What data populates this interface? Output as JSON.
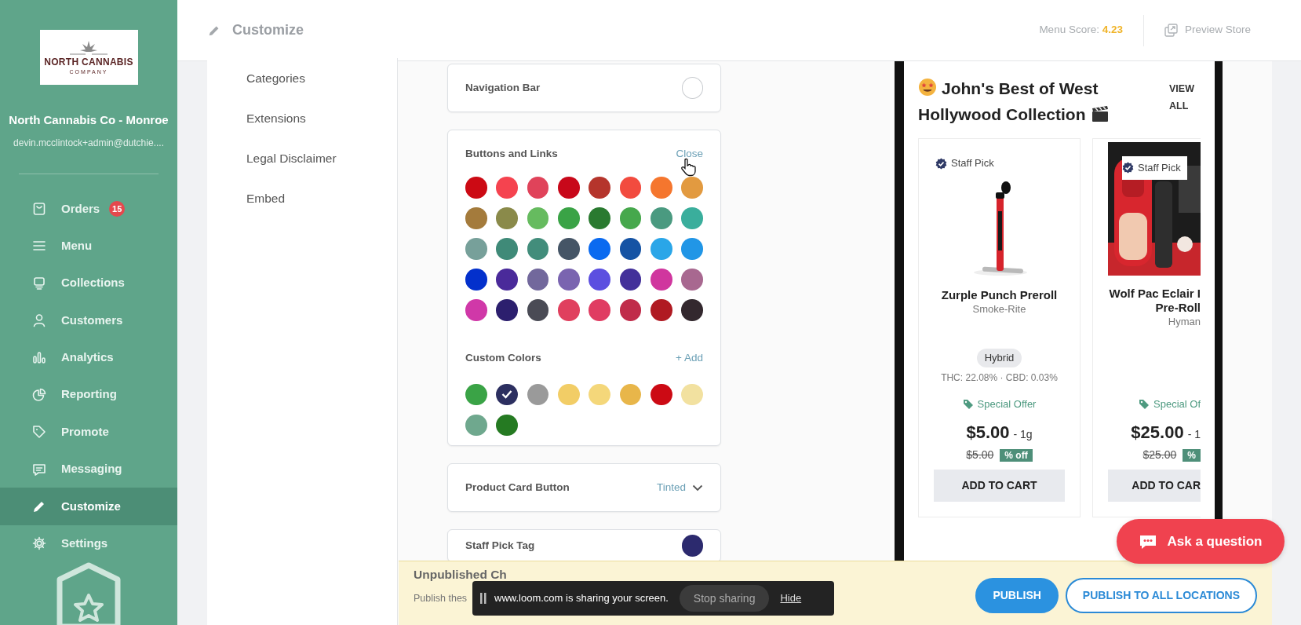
{
  "sidebar": {
    "logo": {
      "name": "NORTH CANNABIS",
      "tagline": "COMPANY"
    },
    "store_name": "North Cannabis Co - Monroe",
    "user_email": "devin.mcclintock+admin@dutchie....",
    "items": [
      {
        "label": "Orders",
        "badge": "15",
        "selected": false
      },
      {
        "label": "Menu",
        "selected": false
      },
      {
        "label": "Collections",
        "selected": false
      },
      {
        "label": "Customers",
        "selected": false
      },
      {
        "label": "Analytics",
        "selected": false
      },
      {
        "label": "Reporting",
        "selected": false
      },
      {
        "label": "Promote",
        "selected": false
      },
      {
        "label": "Messaging",
        "selected": false
      },
      {
        "label": "Customize",
        "selected": true
      },
      {
        "label": "Settings",
        "selected": false
      }
    ]
  },
  "topbar": {
    "title": "Customize",
    "menu_score_label": "Menu Score:",
    "menu_score": "4.23",
    "preview_link": "Preview Store"
  },
  "subnav": {
    "items": [
      "Categories",
      "Extensions",
      "Legal Disclaimer",
      "Embed"
    ]
  },
  "editor": {
    "sections": [
      {
        "kind": "swatch",
        "title": "Navigation Bar",
        "color": "#ffffff"
      },
      {
        "kind": "palette",
        "title": "Buttons and Links",
        "action": "Close",
        "swatches": [
          {
            "color": "#cc0a14",
            "selected": false
          },
          {
            "color": "#f5434f",
            "selected": false
          },
          {
            "color": "#e0435a",
            "selected": false
          },
          {
            "color": "#c8081a",
            "selected": false
          },
          {
            "color": "#b5352c",
            "selected": false
          },
          {
            "color": "#f24b3f",
            "selected": false
          },
          {
            "color": "#f5762e",
            "selected": false
          },
          {
            "color": "#e29a40",
            "selected": false
          },
          {
            "color": "#a47b3c",
            "selected": false
          },
          {
            "color": "#8a8a4a",
            "selected": false
          },
          {
            "color": "#66bb5f",
            "selected": false
          },
          {
            "color": "#3aa346",
            "selected": false
          },
          {
            "color": "#2a7a30",
            "selected": false
          },
          {
            "color": "#46a84c",
            "selected": false
          },
          {
            "color": "#4a9a80",
            "selected": false
          },
          {
            "color": "#3aae9c",
            "selected": false
          },
          {
            "color": "#77a09a",
            "selected": false
          },
          {
            "color": "#3f8a78",
            "selected": false
          },
          {
            "color": "#428d7b",
            "selected": false
          },
          {
            "color": "#455566",
            "selected": false
          },
          {
            "color": "#0a6af0",
            "selected": false
          },
          {
            "color": "#1553a4",
            "selected": false
          },
          {
            "color": "#2aa6e8",
            "selected": false
          },
          {
            "color": "#2196e6",
            "selected": false
          },
          {
            "color": "#0330cc",
            "selected": false
          },
          {
            "color": "#4a2a9a",
            "selected": false
          },
          {
            "color": "#72689c",
            "selected": false
          },
          {
            "color": "#7a64b0",
            "selected": false
          },
          {
            "color": "#5c4fe0",
            "selected": false
          },
          {
            "color": "#43309a",
            "selected": false
          },
          {
            "color": "#d0369e",
            "selected": false
          },
          {
            "color": "#a86890",
            "selected": false
          },
          {
            "color": "#d038a8",
            "selected": false
          },
          {
            "color": "#2c1f6e",
            "selected": false
          },
          {
            "color": "#4a4b55",
            "selected": false
          },
          {
            "color": "#e0405e",
            "selected": false
          },
          {
            "color": "#e03c62",
            "selected": false
          },
          {
            "color": "#c02c4a",
            "selected": false
          },
          {
            "color": "#b01a22",
            "selected": false
          },
          {
            "color": "#33282e",
            "selected": false
          }
        ],
        "custom_title": "Custom Colors",
        "custom_action": "+ Add",
        "custom_swatches": [
          {
            "color": "#3aa346",
            "selected": false
          },
          {
            "color": "#2c2f60",
            "selected": true
          },
          {
            "color": "#9a9a9a",
            "selected": false
          },
          {
            "color": "#f2cd66",
            "selected": false
          },
          {
            "color": "#f4d77a",
            "selected": false
          },
          {
            "color": "#e8b64a",
            "selected": false
          },
          {
            "color": "#cc0a14",
            "selected": false
          },
          {
            "color": "#f2e1a0",
            "selected": false
          },
          {
            "color": "#6fa88e",
            "selected": false
          },
          {
            "color": "#257a22",
            "selected": false
          }
        ]
      },
      {
        "kind": "dropdown",
        "title": "Product Card Button",
        "value": "Tinted"
      },
      {
        "kind": "swatch",
        "title": "Staff Pick Tag",
        "color": "#2c2a6e"
      }
    ]
  },
  "preview": {
    "collection_title": "John's Best of West Hollywood Collection",
    "view_all": "VIEW ALL",
    "products": [
      {
        "tag": "Staff Pick",
        "name_lines": [
          "Zurple Punch Preroll"
        ],
        "brand": "Smoke-Rite",
        "strain": "Hybrid",
        "potency": "THC: 22.08% · CBD: 0.03%",
        "offer": "Special Offer",
        "price": "$5.00",
        "weight": "- 1g",
        "original_price": "$5.00",
        "discount": "% off",
        "button": "ADD TO CART",
        "cut": false
      },
      {
        "tag": "Staff Pick",
        "name_lines": [
          "Wolf Pac Eclair I",
          "Pre-Roll"
        ],
        "brand": "Hyman",
        "offer": "Special Of",
        "price": "$25.00",
        "weight": "- 1",
        "original_price": "$25.00",
        "discount": "%",
        "button": "ADD TO CAR",
        "cut": true
      }
    ]
  },
  "publish_bar": {
    "title": "Unpublished Ch",
    "description": "Publish thes",
    "buttons": [
      {
        "label": "PUBLISH",
        "kind": "primary"
      },
      {
        "label": "PUBLISH TO ALL LOCATIONS",
        "kind": "outline"
      }
    ]
  },
  "screen_share": {
    "message": "www.loom.com is sharing your screen.",
    "stop": "Stop sharing",
    "hide": "Hide"
  },
  "help_button": {
    "label": "Ask a question"
  }
}
